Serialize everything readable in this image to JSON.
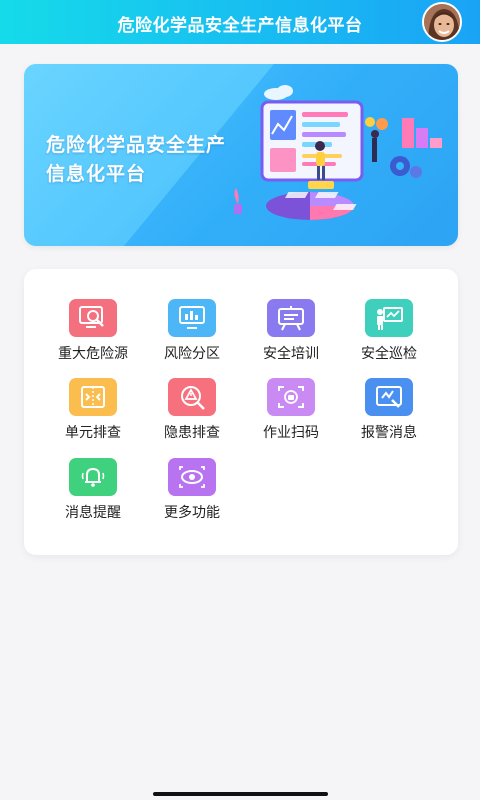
{
  "header": {
    "title": "危险化学品安全生产信息化平台"
  },
  "banner": {
    "line1": "危险化学品安全生产",
    "line2": "信息化平台"
  },
  "menu": {
    "items": [
      {
        "label": "重大危险源",
        "icon": "monitor-search-icon",
        "color": "#f4707f"
      },
      {
        "label": "风险分区",
        "icon": "monitor-chart-icon",
        "color": "#4cb6f6"
      },
      {
        "label": "安全培训",
        "icon": "presentation-board-icon",
        "color": "#8a7af0"
      },
      {
        "label": "安全巡检",
        "icon": "inspection-board-icon",
        "color": "#3ed0bd"
      },
      {
        "label": "单元排查",
        "icon": "unit-check-icon",
        "color": "#fbbd4e"
      },
      {
        "label": "隐患排查",
        "icon": "warning-search-icon",
        "color": "#f6707e"
      },
      {
        "label": "作业扫码",
        "icon": "scan-code-icon",
        "color": "#c98af3"
      },
      {
        "label": "报警消息",
        "icon": "alarm-screen-icon",
        "color": "#4a90f0"
      },
      {
        "label": "消息提醒",
        "icon": "bell-icon",
        "color": "#3fd17e"
      },
      {
        "label": "更多功能",
        "icon": "more-functions-icon",
        "color": "#b873f0"
      }
    ]
  },
  "colors": {
    "header_gradient_start": "#15dbe9",
    "header_gradient_end": "#1aa3f6",
    "banner_blue": "#35b6fb",
    "background": "#f5f5f7"
  }
}
